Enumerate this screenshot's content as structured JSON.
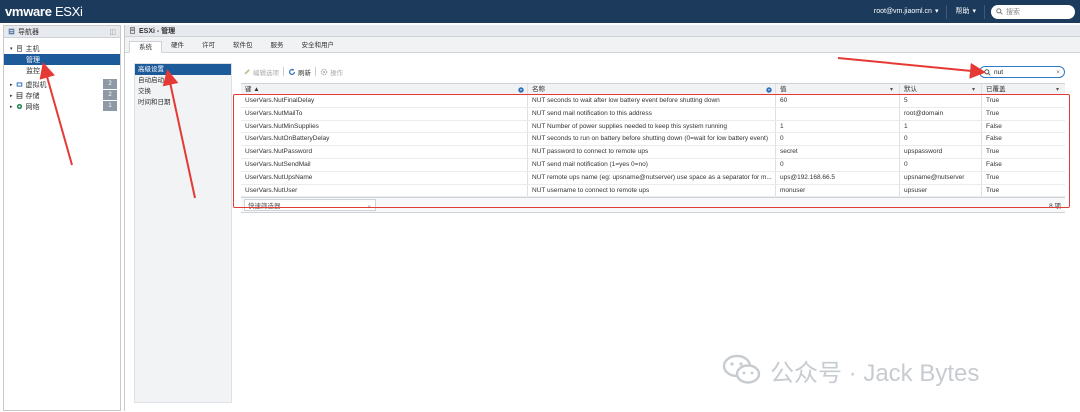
{
  "topbar": {
    "logo_main": "vmware",
    "logo_sub": "ESXi",
    "user": "root@vm.jiaoml.cn",
    "help": "帮助",
    "search_placeholder": "搜索"
  },
  "navigator": {
    "title": "导航器",
    "host_label": "主机",
    "host_children": [
      "管理",
      "监控"
    ],
    "items": [
      {
        "label": "虚拟机",
        "count": "2"
      },
      {
        "label": "存储",
        "count": "2"
      },
      {
        "label": "网络",
        "count": "1"
      }
    ]
  },
  "main": {
    "title": "ESXi - 管理",
    "tabs": [
      "系统",
      "硬件",
      "许可",
      "软件包",
      "服务",
      "安全和用户"
    ],
    "side_menu": [
      "高级设置",
      "自动启动",
      "交换",
      "时间和日期"
    ],
    "toolbar": {
      "edit": "编辑选项",
      "refresh": "刷新",
      "actions": "操作"
    },
    "filter_value": "nut",
    "columns": [
      "键 ▲",
      "名称",
      "值",
      "默认",
      "已覆盖"
    ],
    "rows": [
      [
        "UserVars.NutFinalDelay",
        "NUT seconds to wait after low battery event before shutting down",
        "60",
        "5",
        "True"
      ],
      [
        "UserVars.NutMailTo",
        "NUT send mail notification to this address",
        "",
        "root@domain",
        "True"
      ],
      [
        "UserVars.NutMinSupplies",
        "NUT Number of power supplies needed to keep this system running",
        "1",
        "1",
        "False"
      ],
      [
        "UserVars.NutOnBatteryDelay",
        "NUT seconds to run on battery before shutting down (0=wait for low battery event)",
        "0",
        "0",
        "False"
      ],
      [
        "UserVars.NutPassword",
        "NUT password to connect to remote ups",
        "secret",
        "upspassword",
        "True"
      ],
      [
        "UserVars.NutSendMail",
        "NUT send mail notification (1=yes 0=no)",
        "0",
        "0",
        "False"
      ],
      [
        "UserVars.NutUpsName",
        "NUT remote ups name (eg: upsname@nutserver) use space as a separator for m...",
        "ups@192.168.66.5",
        "upsname@nutserver",
        "True"
      ],
      [
        "UserVars.NutUser",
        "NUT username to connect to remote ups",
        "monuser",
        "upsuser",
        "True"
      ]
    ],
    "quick_filter": "快速筛选器...",
    "count": "8 项"
  },
  "watermark": "公众号 · Jack Bytes",
  "colors": {
    "topbar": "#1c3b5c",
    "selected": "#1c5a9a",
    "annotation": "#e53935"
  }
}
